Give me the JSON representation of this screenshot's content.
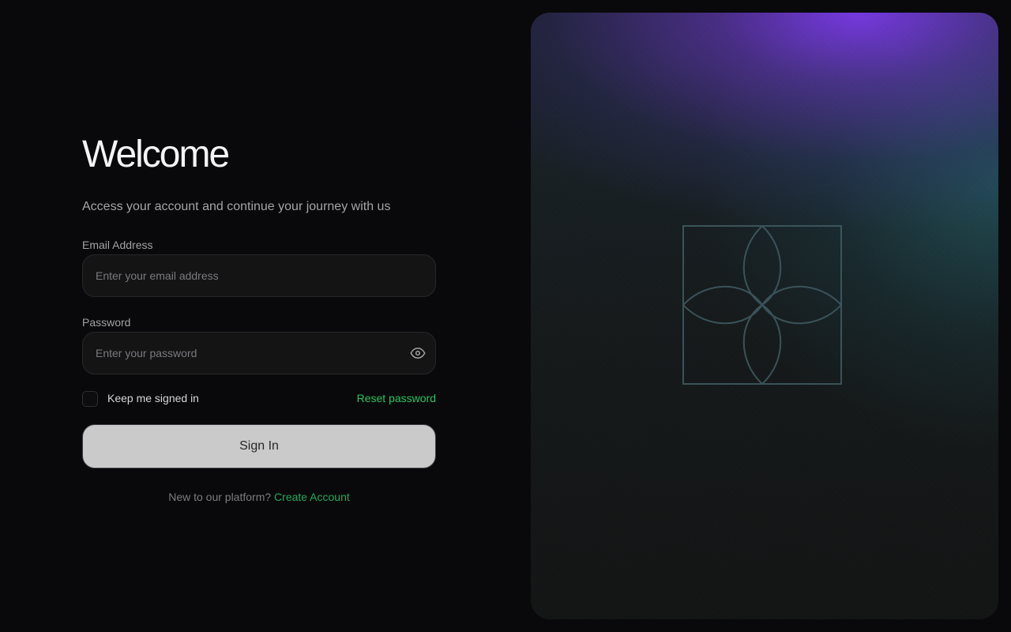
{
  "login": {
    "title": "Welcome",
    "subtitle": "Access your account and continue your journey with us",
    "email": {
      "label": "Email Address",
      "placeholder": "Enter your email address",
      "value": ""
    },
    "password": {
      "label": "Password",
      "placeholder": "Enter your password",
      "value": "",
      "toggle_icon": "eye-icon"
    },
    "remember_label": "Keep me signed in",
    "remember_checked": false,
    "reset_link": "Reset password",
    "submit_label": "Sign In",
    "footer": {
      "prompt": "New to our platform?",
      "link": "Create Account"
    }
  },
  "hero": {
    "logo_icon": "quatrefoil-square-logo",
    "colors": {
      "top_glow": "#7c3aed",
      "mid_glow": "#286e78",
      "base": "#131414"
    }
  },
  "colors": {
    "background": "#09090b",
    "accent": "#22c55e",
    "button_bg": "#cacaca"
  }
}
